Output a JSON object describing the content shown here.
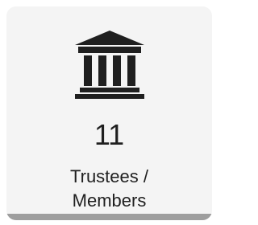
{
  "card": {
    "icon": "bank-building-icon",
    "count": "11",
    "label_line1": "Trustees /",
    "label_line2": "Members"
  },
  "colors": {
    "card_background": "#f4f4f4",
    "icon": "#1f1f1f",
    "text": "#1f1f1f",
    "bottom_bar": "#9e9e9e"
  }
}
